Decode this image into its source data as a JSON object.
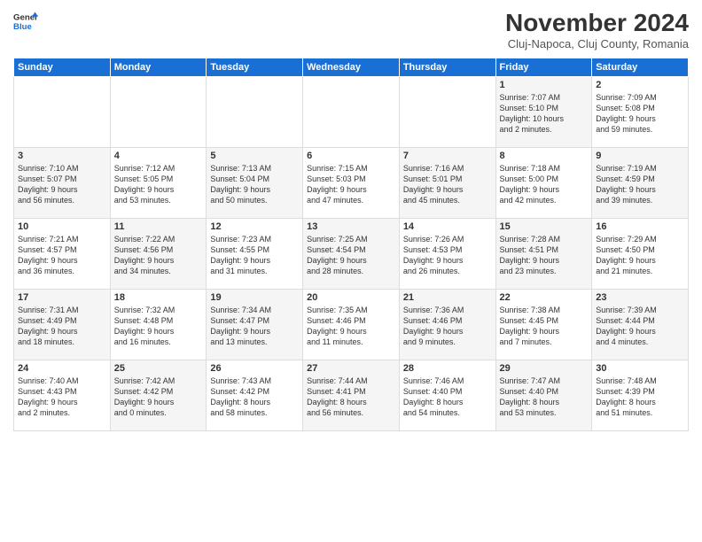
{
  "logo": {
    "line1": "General",
    "line2": "Blue"
  },
  "title": "November 2024",
  "subtitle": "Cluj-Napoca, Cluj County, Romania",
  "headers": [
    "Sunday",
    "Monday",
    "Tuesday",
    "Wednesday",
    "Thursday",
    "Friday",
    "Saturday"
  ],
  "rows": [
    [
      {
        "day": "",
        "text": "",
        "empty": true
      },
      {
        "day": "",
        "text": "",
        "empty": true
      },
      {
        "day": "",
        "text": "",
        "empty": true
      },
      {
        "day": "",
        "text": "",
        "empty": true
      },
      {
        "day": "",
        "text": "",
        "empty": true
      },
      {
        "day": "1",
        "text": "Sunrise: 7:07 AM\nSunset: 5:10 PM\nDaylight: 10 hours\nand 2 minutes.",
        "shaded": true
      },
      {
        "day": "2",
        "text": "Sunrise: 7:09 AM\nSunset: 5:08 PM\nDaylight: 9 hours\nand 59 minutes.",
        "shaded": false
      }
    ],
    [
      {
        "day": "3",
        "text": "Sunrise: 7:10 AM\nSunset: 5:07 PM\nDaylight: 9 hours\nand 56 minutes.",
        "shaded": true
      },
      {
        "day": "4",
        "text": "Sunrise: 7:12 AM\nSunset: 5:05 PM\nDaylight: 9 hours\nand 53 minutes.",
        "shaded": false
      },
      {
        "day": "5",
        "text": "Sunrise: 7:13 AM\nSunset: 5:04 PM\nDaylight: 9 hours\nand 50 minutes.",
        "shaded": true
      },
      {
        "day": "6",
        "text": "Sunrise: 7:15 AM\nSunset: 5:03 PM\nDaylight: 9 hours\nand 47 minutes.",
        "shaded": false
      },
      {
        "day": "7",
        "text": "Sunrise: 7:16 AM\nSunset: 5:01 PM\nDaylight: 9 hours\nand 45 minutes.",
        "shaded": true
      },
      {
        "day": "8",
        "text": "Sunrise: 7:18 AM\nSunset: 5:00 PM\nDaylight: 9 hours\nand 42 minutes.",
        "shaded": false
      },
      {
        "day": "9",
        "text": "Sunrise: 7:19 AM\nSunset: 4:59 PM\nDaylight: 9 hours\nand 39 minutes.",
        "shaded": true
      }
    ],
    [
      {
        "day": "10",
        "text": "Sunrise: 7:21 AM\nSunset: 4:57 PM\nDaylight: 9 hours\nand 36 minutes.",
        "shaded": false
      },
      {
        "day": "11",
        "text": "Sunrise: 7:22 AM\nSunset: 4:56 PM\nDaylight: 9 hours\nand 34 minutes.",
        "shaded": true
      },
      {
        "day": "12",
        "text": "Sunrise: 7:23 AM\nSunset: 4:55 PM\nDaylight: 9 hours\nand 31 minutes.",
        "shaded": false
      },
      {
        "day": "13",
        "text": "Sunrise: 7:25 AM\nSunset: 4:54 PM\nDaylight: 9 hours\nand 28 minutes.",
        "shaded": true
      },
      {
        "day": "14",
        "text": "Sunrise: 7:26 AM\nSunset: 4:53 PM\nDaylight: 9 hours\nand 26 minutes.",
        "shaded": false
      },
      {
        "day": "15",
        "text": "Sunrise: 7:28 AM\nSunset: 4:51 PM\nDaylight: 9 hours\nand 23 minutes.",
        "shaded": true
      },
      {
        "day": "16",
        "text": "Sunrise: 7:29 AM\nSunset: 4:50 PM\nDaylight: 9 hours\nand 21 minutes.",
        "shaded": false
      }
    ],
    [
      {
        "day": "17",
        "text": "Sunrise: 7:31 AM\nSunset: 4:49 PM\nDaylight: 9 hours\nand 18 minutes.",
        "shaded": true
      },
      {
        "day": "18",
        "text": "Sunrise: 7:32 AM\nSunset: 4:48 PM\nDaylight: 9 hours\nand 16 minutes.",
        "shaded": false
      },
      {
        "day": "19",
        "text": "Sunrise: 7:34 AM\nSunset: 4:47 PM\nDaylight: 9 hours\nand 13 minutes.",
        "shaded": true
      },
      {
        "day": "20",
        "text": "Sunrise: 7:35 AM\nSunset: 4:46 PM\nDaylight: 9 hours\nand 11 minutes.",
        "shaded": false
      },
      {
        "day": "21",
        "text": "Sunrise: 7:36 AM\nSunset: 4:46 PM\nDaylight: 9 hours\nand 9 minutes.",
        "shaded": true
      },
      {
        "day": "22",
        "text": "Sunrise: 7:38 AM\nSunset: 4:45 PM\nDaylight: 9 hours\nand 7 minutes.",
        "shaded": false
      },
      {
        "day": "23",
        "text": "Sunrise: 7:39 AM\nSunset: 4:44 PM\nDaylight: 9 hours\nand 4 minutes.",
        "shaded": true
      }
    ],
    [
      {
        "day": "24",
        "text": "Sunrise: 7:40 AM\nSunset: 4:43 PM\nDaylight: 9 hours\nand 2 minutes.",
        "shaded": false
      },
      {
        "day": "25",
        "text": "Sunrise: 7:42 AM\nSunset: 4:42 PM\nDaylight: 9 hours\nand 0 minutes.",
        "shaded": true
      },
      {
        "day": "26",
        "text": "Sunrise: 7:43 AM\nSunset: 4:42 PM\nDaylight: 8 hours\nand 58 minutes.",
        "shaded": false
      },
      {
        "day": "27",
        "text": "Sunrise: 7:44 AM\nSunset: 4:41 PM\nDaylight: 8 hours\nand 56 minutes.",
        "shaded": true
      },
      {
        "day": "28",
        "text": "Sunrise: 7:46 AM\nSunset: 4:40 PM\nDaylight: 8 hours\nand 54 minutes.",
        "shaded": false
      },
      {
        "day": "29",
        "text": "Sunrise: 7:47 AM\nSunset: 4:40 PM\nDaylight: 8 hours\nand 53 minutes.",
        "shaded": true
      },
      {
        "day": "30",
        "text": "Sunrise: 7:48 AM\nSunset: 4:39 PM\nDaylight: 8 hours\nand 51 minutes.",
        "shaded": false
      }
    ]
  ]
}
